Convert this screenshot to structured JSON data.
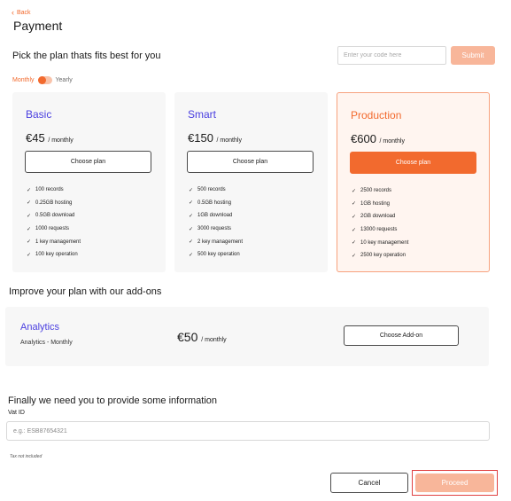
{
  "header": {
    "back_label": "Back",
    "title": "Payment"
  },
  "plan_section": {
    "subtitle": "Pick the plan thats fits best for you",
    "code_placeholder": "Enter your code here",
    "submit_label": "Submit",
    "billing_toggle": {
      "monthly_label": "Monthly",
      "yearly_label": "Yearly",
      "selected": "Monthly"
    }
  },
  "plans": [
    {
      "name": "Basic",
      "price": "€45",
      "period": "/ monthly",
      "button_label": "Choose plan",
      "features": [
        "100 records",
        "0.25GB hosting",
        "0.5GB download",
        "1000 requests",
        "1 key management",
        "100 key operation"
      ]
    },
    {
      "name": "Smart",
      "price": "€150",
      "period": "/ monthly",
      "button_label": "Choose plan",
      "features": [
        "500 records",
        "0.5GB hosting",
        "1GB download",
        "3000 requests",
        "2 key management",
        "500 key operation"
      ]
    },
    {
      "name": "Production",
      "price": "€600",
      "period": "/ monthly",
      "button_label": "Choose plan",
      "features": [
        "2500 records",
        "1GB hosting",
        "2GB download",
        "13000 requests",
        "10 key management",
        "2500 key operation"
      ]
    }
  ],
  "addons": {
    "title": "Improve your plan with our add-ons",
    "item": {
      "name": "Analytics",
      "subtitle": "Analytics - Monthly",
      "price": "€50",
      "period": "/ monthly",
      "button_label": "Choose Add-on"
    }
  },
  "info": {
    "title": "Finally we need you to provide some information",
    "vat_label": "Vat ID",
    "vat_placeholder": "e.g.: ESB87654321",
    "tax_note": "Tax not included"
  },
  "footer": {
    "cancel_label": "Cancel",
    "proceed_label": "Proceed"
  },
  "colors": {
    "accent": "#f26a2e",
    "accent_light": "#f8b69a",
    "plan_name": "#4a3fe0",
    "highlight_border": "#e04141"
  }
}
